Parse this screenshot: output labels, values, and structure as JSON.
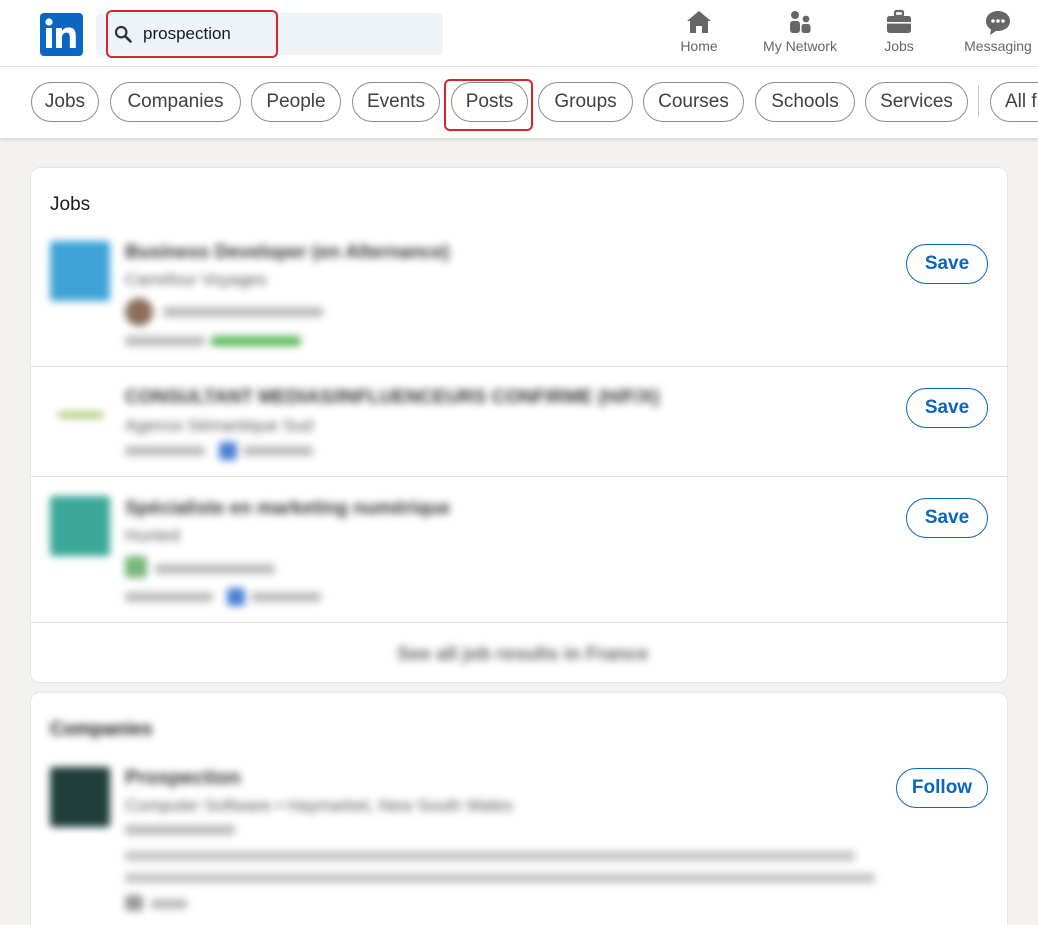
{
  "search": {
    "query": "prospection"
  },
  "nav": {
    "items": [
      {
        "label": "Home",
        "icon": "home-icon"
      },
      {
        "label": "My Network",
        "icon": "network-icon"
      },
      {
        "label": "Jobs",
        "icon": "briefcase-icon"
      },
      {
        "label": "Messaging",
        "icon": "messaging-icon"
      }
    ]
  },
  "filters": {
    "pills": [
      "Jobs",
      "Companies",
      "People",
      "Events",
      "Posts",
      "Groups",
      "Courses",
      "Schools",
      "Services",
      "All f"
    ]
  },
  "jobs_section": {
    "title": "Jobs",
    "results": [
      {
        "title": "Business Developer (en Alternance)",
        "company": "Carrefour Voyages",
        "save_label": "Save"
      },
      {
        "title": "CONSULTANT MEDIAS/INFLUENCEURS CONFIRME (H/F/X)",
        "company": "Agence Sémantique Sud",
        "save_label": "Save"
      },
      {
        "title": "Spécialiste en marketing numérique",
        "company": "Hunted",
        "save_label": "Save"
      }
    ],
    "see_all": "See all job results in France"
  },
  "companies_section": {
    "title": "Companies",
    "results": [
      {
        "name": "Prospection",
        "details": "Computer Software • Haymarket, New South Wales",
        "follow_label": "Follow"
      }
    ]
  },
  "colors": {
    "brand": "#0a66c2",
    "highlight": "#d9232f",
    "background": "#f3f2ef"
  }
}
